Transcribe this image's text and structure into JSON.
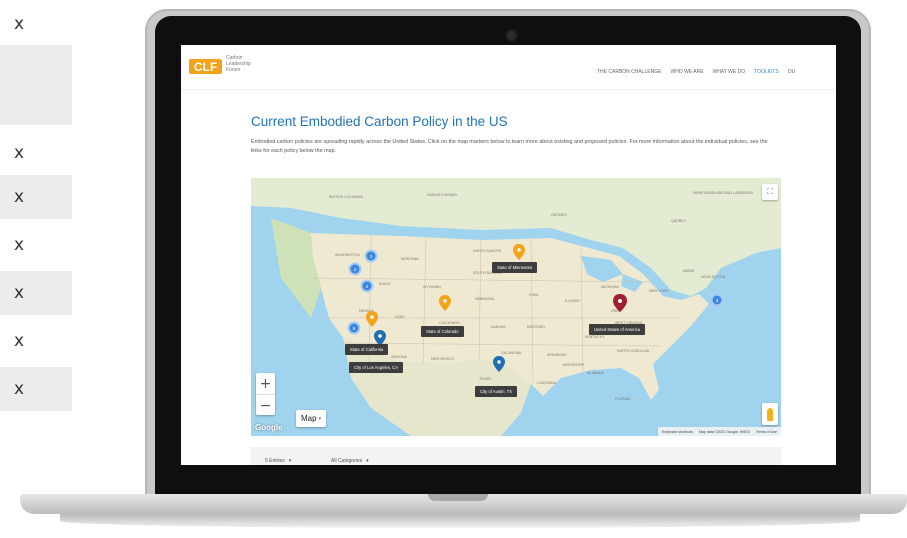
{
  "side_panel": {
    "close_labels": [
      "x",
      "x",
      "x",
      "x",
      "x",
      "x",
      "x"
    ]
  },
  "site": {
    "logo_mark": "CLF",
    "logo_text": "Carbon Leadership Forum",
    "nav": [
      "THE CARBON CHALLENGE",
      "WHO WE ARE",
      "WHAT WE DO",
      "TOOLKITS",
      "OU"
    ],
    "active_nav": "TOOLKITS"
  },
  "page": {
    "title": "Current Embodied Carbon Policy in the US",
    "description": "Embodied carbon policies are spreading rapidly across the United States. Click on the map markers below to learn more about existing and proposed policies.  For more information about the individual policies, see the links for each policy below the map."
  },
  "map": {
    "labels": {
      "british_columbia": "BRITISH COLUMBIA",
      "saskatchewan": "SASKATCHEWAN",
      "ontario": "ONTARIO",
      "newfoundland": "NEWFOUNDLAND AND LABRADOR",
      "quebec": "QUEBEC",
      "washington": "WASHINGTON",
      "montana": "MONTANA",
      "north_dakota": "NORTH DAKOTA",
      "south_dakota": "SOUTH DAKOTA",
      "idaho": "IDAHO",
      "wyoming": "WYOMING",
      "nevada": "NEVADA",
      "utah": "UTAH",
      "colorado": "COLORADO",
      "nebraska": "NEBRASKA",
      "iowa": "IOWA",
      "illinois": "ILLINOIS",
      "michigan": "MICHIGAN",
      "kansas": "KANSAS",
      "missouri": "MISSOURI",
      "arizona": "ARIZONA",
      "new_mexico": "NEW MEXICO",
      "oklahoma": "OKLAHOMA",
      "arkansas": "ARKANSAS",
      "mississippi": "MISSISSIPPI",
      "alabama": "ALABAMA",
      "texas": "TEXAS",
      "louisiana": "LOUISIANA",
      "florida": "FLORIDA",
      "kentucky": "KENTUCKY",
      "north_carolina": "NORTH CAROLINA",
      "new_york": "NEW YORK",
      "maine": "MAINE",
      "nova_scotia": "NOVA SCOTIA",
      "ohio": "OHIO",
      "west_virginia": "WEST VIRGINIA"
    },
    "tooltips": {
      "minnesota": "State of Minnesota",
      "colorado": "State of Colorado",
      "usa": "United States of America",
      "california": "State of California",
      "los_angeles": "City of Los Angeles, CA",
      "austin": "City of Austin, TX"
    },
    "clusters": [
      "3",
      "2",
      "2",
      "5",
      "3"
    ],
    "zoom_in": "+",
    "zoom_out": "−",
    "map_type": "Map",
    "map_type_caret": "▾",
    "fullscreen_icon": "⛶",
    "google": "Google",
    "attribution": [
      "Keyboard shortcuts",
      "Map data ©2021 Google, INEGI",
      "Terms of Use"
    ],
    "colors": {
      "water": "#9fd3ee",
      "land": "#e8efd9",
      "usa_land": "#f1ecd8",
      "marker_blue": "#1f6fb5",
      "marker_orange": "#f2a31a",
      "marker_red": "#a01f33",
      "cluster_blue": "#3b86e0"
    }
  },
  "filters": {
    "entries": "5 Entries",
    "categories": "All Categories",
    "caret": "▾"
  }
}
